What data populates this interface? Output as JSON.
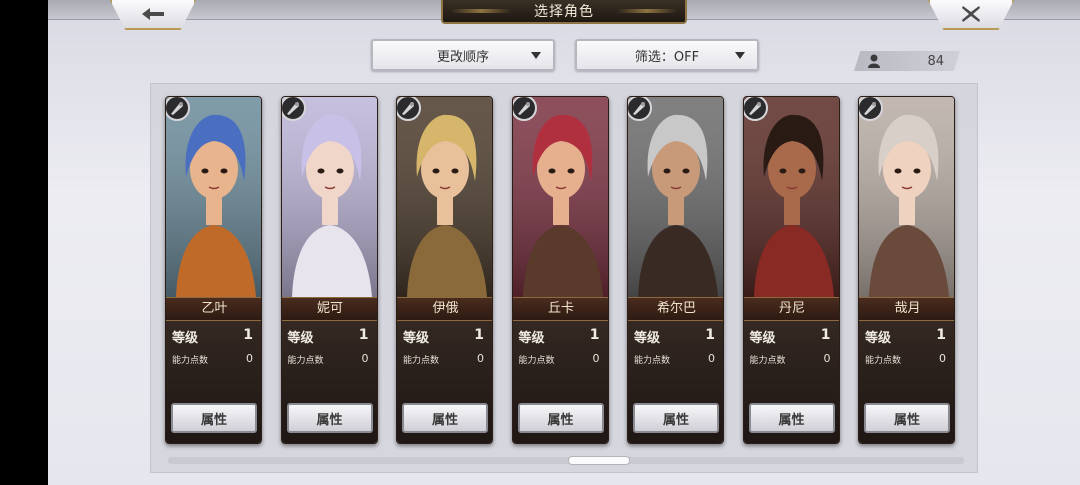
{
  "header": {
    "title": "选择角色",
    "back_icon": "arrow-left-icon",
    "close_icon": "close-x-icon"
  },
  "toolbar": {
    "sort_label": "更改顺序",
    "filter_label": "筛选：OFF",
    "character_count": "84"
  },
  "labels": {
    "level": "等级",
    "ability_points": "能力点数",
    "attribute_button": "属性"
  },
  "characters": [
    {
      "name": "乙叶",
      "level": "1",
      "ability_points": "0",
      "hair": "#4a6ec0",
      "skin": "#e8b48e",
      "outfit": "#c06a2a",
      "bg": "#6a8a9a"
    },
    {
      "name": "妮可",
      "level": "1",
      "ability_points": "0",
      "hair": "#c8c0e6",
      "skin": "#f0d6c8",
      "outfit": "#e8e4ee",
      "bg": "#bcb4d8"
    },
    {
      "name": "伊俄",
      "level": "1",
      "ability_points": "0",
      "hair": "#d6b66a",
      "skin": "#e8c09a",
      "outfit": "#8a6a3a",
      "bg": "#4a3a2a"
    },
    {
      "name": "丘卡",
      "level": "1",
      "ability_points": "0",
      "hair": "#b03040",
      "skin": "#e6b08e",
      "outfit": "#5a3a2a",
      "bg": "#7a3040"
    },
    {
      "name": "希尔巴",
      "level": "1",
      "ability_points": "0",
      "hair": "#c8c8c8",
      "skin": "#c89a7a",
      "outfit": "#3a2a24",
      "bg": "#6a6a6a"
    },
    {
      "name": "丹尼",
      "level": "1",
      "ability_points": "0",
      "hair": "#2a1a14",
      "skin": "#a86a4a",
      "outfit": "#8a2a24",
      "bg": "#5a2a24"
    },
    {
      "name": "哉月",
      "level": "1",
      "ability_points": "0",
      "hair": "#d8d0c8",
      "skin": "#f0d2c0",
      "outfit": "#6a4a3a",
      "bg": "#b8aca4"
    }
  ],
  "colors": {
    "gold_border": "#b89a52",
    "card_dark": "#2a201c"
  }
}
